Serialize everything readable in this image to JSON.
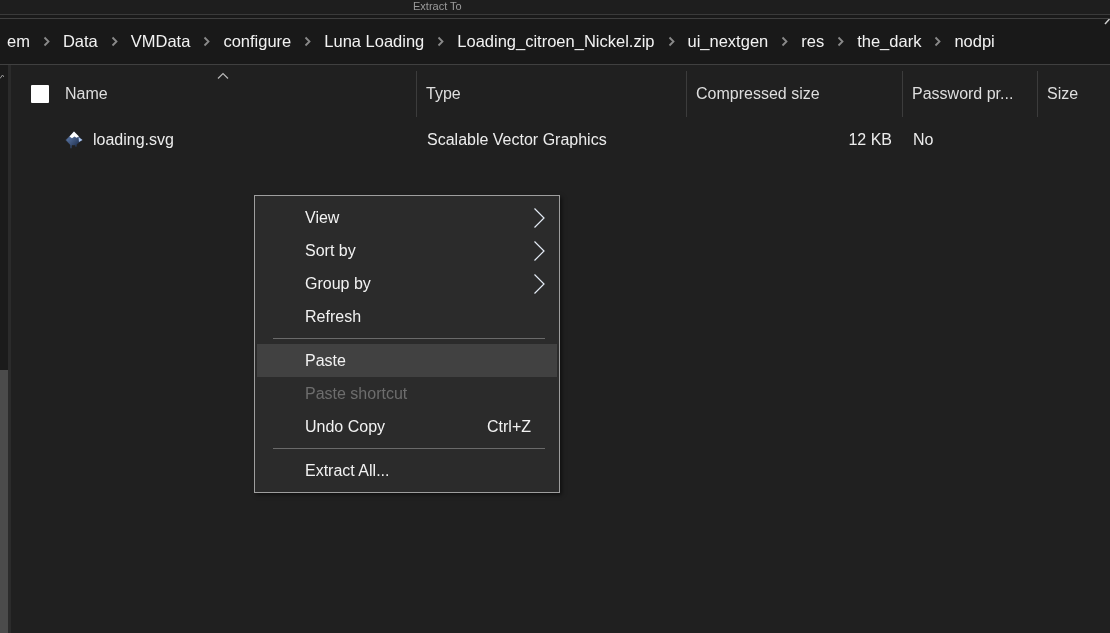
{
  "ribbon": {
    "tab": "Extract To"
  },
  "address_bar": {
    "crumbs": [
      "em",
      "Data",
      "VMData",
      "configure",
      "Luna Loading",
      "Loading_citroen_Nickel.zip",
      "ui_nextgen",
      "res",
      "the_dark",
      "nodpi"
    ]
  },
  "file_list": {
    "select_all_checked": false,
    "columns": [
      {
        "label": "Name",
        "sorted": true
      },
      {
        "label": "Type",
        "sorted": false
      },
      {
        "label": "Compressed size",
        "sorted": false
      },
      {
        "label": "Password pr...",
        "sorted": false
      },
      {
        "label": "Size",
        "sorted": false
      }
    ],
    "rows": [
      {
        "name": "loading.svg",
        "type": "Scalable Vector Graphics",
        "compressed_size": "12 KB",
        "password_protected": "No",
        "selected": false
      }
    ]
  },
  "context_menu": {
    "items": [
      {
        "kind": "item",
        "label": "View",
        "submenu": true,
        "disabled": false,
        "selected": false
      },
      {
        "kind": "item",
        "label": "Sort by",
        "submenu": true,
        "disabled": false,
        "selected": false
      },
      {
        "kind": "item",
        "label": "Group by",
        "submenu": true,
        "disabled": false,
        "selected": false
      },
      {
        "kind": "item",
        "label": "Refresh",
        "submenu": false,
        "disabled": false,
        "selected": false
      },
      {
        "kind": "separator"
      },
      {
        "kind": "item",
        "label": "Paste",
        "submenu": false,
        "disabled": false,
        "selected": true
      },
      {
        "kind": "item",
        "label": "Paste shortcut",
        "submenu": false,
        "disabled": true,
        "selected": false
      },
      {
        "kind": "item",
        "label": "Undo Copy",
        "shortcut": "Ctrl+Z",
        "submenu": false,
        "disabled": false,
        "selected": false
      },
      {
        "kind": "separator"
      },
      {
        "kind": "item",
        "label": "Extract All...",
        "submenu": false,
        "disabled": false,
        "selected": false
      }
    ]
  }
}
